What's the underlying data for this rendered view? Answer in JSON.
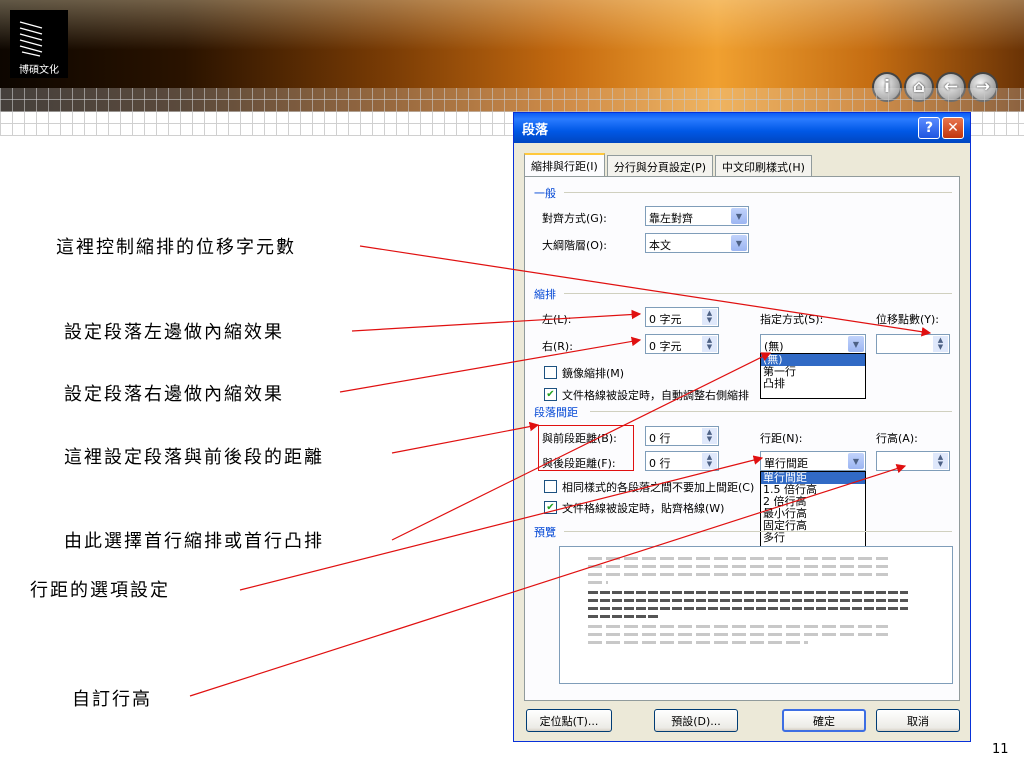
{
  "header": {
    "logo_text": "博碩文化"
  },
  "nav_buttons": [
    {
      "name": "info-button",
      "glyph": "i"
    },
    {
      "name": "home-button",
      "glyph": "⌂"
    },
    {
      "name": "back-button",
      "glyph": "←"
    },
    {
      "name": "forward-button",
      "glyph": "→"
    }
  ],
  "annotations": [
    "這裡控制縮排的位移字元數",
    "設定段落左邊做內縮效果",
    "設定段落右邊做內縮效果",
    "這裡設定段落與前後段的距離",
    "由此選擇首行縮排或首行凸排",
    "行距的選項設定",
    "自訂行高"
  ],
  "dialog": {
    "title": "段落",
    "help_label": "?",
    "close_label": "✕",
    "tabs": [
      "縮排與行距(I)",
      "分行與分頁設定(P)",
      "中文印刷樣式(H)"
    ],
    "general": {
      "section": "一般",
      "alignment_label": "對齊方式(G):",
      "alignment_value": "靠左對齊",
      "outline_label": "大綱階層(O):",
      "outline_value": "本文"
    },
    "indent": {
      "section": "縮排",
      "left_label": "左(L):",
      "left_value": "0 字元",
      "right_label": "右(R):",
      "right_value": "0 字元",
      "special_label": "指定方式(S):",
      "special_value": "(無)",
      "by_label": "位移點數(Y):",
      "by_value": "",
      "special_options": [
        "(無)",
        "第一行",
        "凸排"
      ],
      "mirror_label": "鏡像縮排(M)",
      "auto_adjust_label": "文件格線被設定時，自動調整右側縮排",
      "mirror_checked": false,
      "auto_adjust_checked": true
    },
    "spacing": {
      "section": "段落間距",
      "before_label": "與前段距離(B):",
      "before_value": "0 行",
      "after_label": "與後段距離(F):",
      "after_value": "0 行",
      "line_spacing_label": "行距(N):",
      "line_spacing_value": "單行間距",
      "at_label": "行高(A):",
      "at_value": "",
      "line_spacing_options": [
        "單行間距",
        "1.5 倍行高",
        "2 倍行高",
        "最小行高",
        "固定行高",
        "多行"
      ],
      "no_space_label": "相同樣式的各段落之間不要加上間距(C)",
      "snap_grid_label": "文件格線被設定時，貼齊格線(W)",
      "no_space_checked": false,
      "snap_grid_checked": true
    },
    "preview": {
      "section": "預覽"
    },
    "buttons": {
      "tabs": "定位點(T)...",
      "default": "預設(D)...",
      "ok": "確定",
      "cancel": "取消"
    }
  },
  "page_number": "11",
  "colors": {
    "arrow": "#e01010",
    "accent": "#0046d5"
  }
}
